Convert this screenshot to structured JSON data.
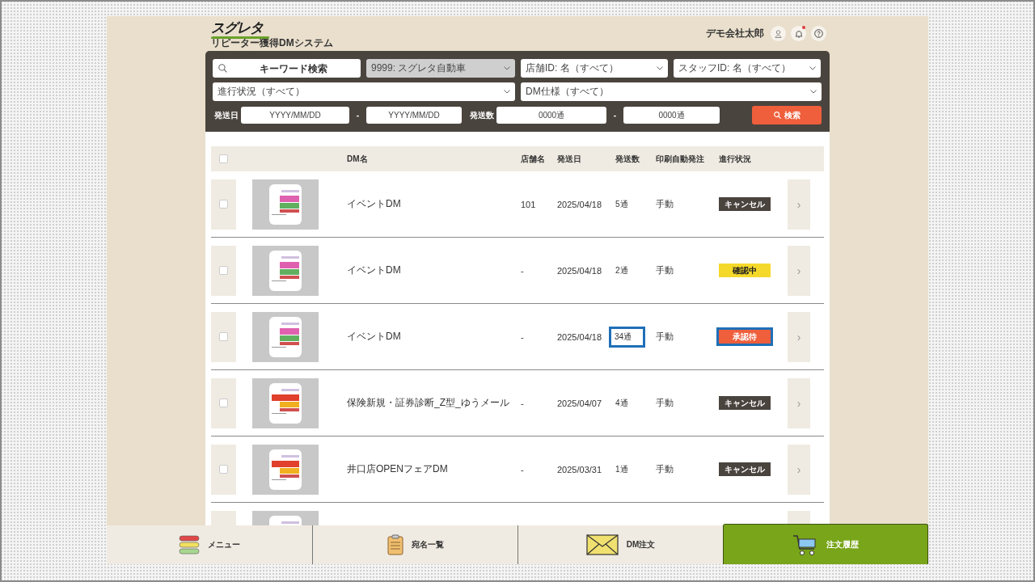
{
  "header": {
    "logo": "スグレタ",
    "tagline": "リピーター獲得DMシステム",
    "user_name": "デモ会社太郎",
    "has_notification": true
  },
  "filters": {
    "keyword": {
      "placeholder": "キーワード検索"
    },
    "company": {
      "value": "9999: スグレタ自動車",
      "disabled": true
    },
    "store": {
      "value": "店舗ID: 名（すべて）",
      "disabled": false
    },
    "staff": {
      "value": "スタッフID: 名（すべて）",
      "disabled": false
    },
    "progress": {
      "value": "進行状況（すべて）",
      "disabled": false
    },
    "dm_spec": {
      "value": "DM仕様（すべて）",
      "disabled": false
    },
    "send_date_label": "発送日",
    "date_from": {
      "placeholder": "YYYY/MM/DD"
    },
    "date_sep": "-",
    "date_to": {
      "placeholder": "YYYY/MM/DD"
    },
    "count_label": "発送数",
    "count_from": {
      "placeholder": "0000通"
    },
    "count_sep": "-",
    "count_to": {
      "placeholder": "0000通"
    },
    "search_button": "検索"
  },
  "table": {
    "select_all_checked": false,
    "columns": [
      "DM名",
      "店舗名",
      "発送日",
      "発送数",
      "印刷自動発注",
      "進行状況"
    ],
    "rows": [
      {
        "kind": "full",
        "checked": false,
        "name": "イベントDM",
        "store": "101",
        "date": "2025/04/18",
        "count": "5通",
        "count_highlighted": false,
        "print": "手動",
        "status": {
          "label": "キャンセル",
          "color": "#4a443e"
        },
        "status_highlighted": false,
        "arrow": "›"
      },
      {
        "kind": "full",
        "checked": false,
        "name": "イベントDM",
        "store": "-",
        "date": "2025/04/18",
        "count": "2通",
        "count_highlighted": false,
        "print": "手動",
        "status": {
          "label": "確認中",
          "color": "#f5d92a"
        },
        "status_highlighted": false,
        "arrow": "›"
      },
      {
        "kind": "full",
        "checked": false,
        "name": "イベントDM",
        "store": "-",
        "date": "2025/04/18",
        "count": "34通",
        "count_highlighted": true,
        "print": "手動",
        "status": {
          "label": "承認待",
          "color": "#ef5f3c"
        },
        "status_highlighted": true,
        "arrow": "›"
      },
      {
        "kind": "full",
        "checked": false,
        "name": "保険新規・証券診断_Z型_ゆうメール",
        "store": "-",
        "date": "2025/04/07",
        "count": "4通",
        "count_highlighted": false,
        "print": "手動",
        "status": {
          "label": "キャンセル",
          "color": "#4a443e"
        },
        "status_highlighted": false,
        "arrow": "›"
      },
      {
        "kind": "full",
        "checked": false,
        "name": "井口店OPENフェアDM",
        "store": "-",
        "date": "2025/03/31",
        "count": "1通",
        "count_highlighted": false,
        "print": "手動",
        "status": {
          "label": "キャンセル",
          "color": "#4a443e"
        },
        "status_highlighted": false,
        "arrow": "›"
      },
      {
        "kind": "partial"
      }
    ]
  },
  "bottom_nav": [
    {
      "kind": "menu",
      "label": "メニュー",
      "selected": false
    },
    {
      "kind": "clipboard",
      "label": "宛名一覧",
      "selected": false
    },
    {
      "kind": "envelope",
      "label": "DM注文",
      "selected": false
    },
    {
      "kind": "cart",
      "label": "注文履歴",
      "selected": true
    }
  ]
}
